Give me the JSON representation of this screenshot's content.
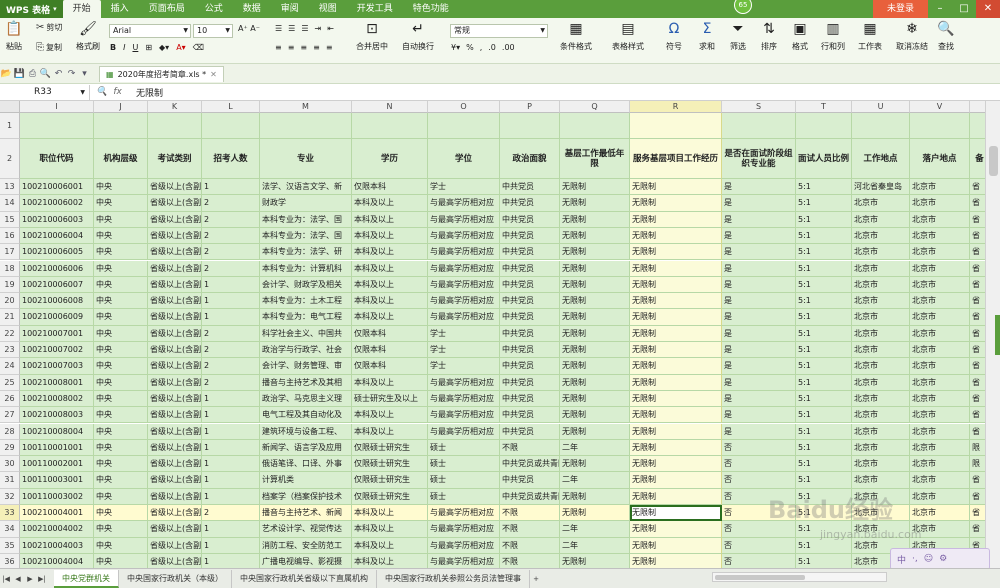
{
  "app": {
    "logo": "WPS 表格",
    "badge": "65",
    "login": "未登录"
  },
  "menu": [
    "开始",
    "插入",
    "页面布局",
    "公式",
    "数据",
    "审阅",
    "视图",
    "开发工具",
    "特色功能"
  ],
  "ribbon": {
    "paste": "粘贴",
    "cut": "剪切",
    "copy": "复制",
    "format_painter": "格式刷",
    "font_name": "Arial",
    "font_size": "10",
    "number_format": "常规",
    "merge_center": "合并居中",
    "wrap": "自动换行",
    "cond_format": "条件格式",
    "table_style": "表格样式",
    "symbol": "符号",
    "sum": "求和",
    "filter": "筛选",
    "sort": "排序",
    "format": "格式",
    "row_col": "行和列",
    "worksheet": "工作表",
    "freeze": "取消冻结",
    "find": "查找"
  },
  "doc_tab": "2020年度招考简章.xls *",
  "formula": {
    "cell_ref": "R33",
    "fx": "fx",
    "content": "无限制"
  },
  "columns": [
    "I",
    "J",
    "K",
    "L",
    "M",
    "N",
    "O",
    "P",
    "Q",
    "R",
    "S",
    "T",
    "U",
    "V",
    ""
  ],
  "header_row": {
    "row": "2",
    "cells": [
      "职位代码",
      "机构层级",
      "考试类别",
      "招考人数",
      "专业",
      "学历",
      "学位",
      "政治面貌",
      "基层工作最低年限",
      "服务基层项目工作经历",
      "是否在面试阶段组织专业能",
      "面试人员比例",
      "工作地点",
      "落户地点",
      "备"
    ]
  },
  "rows": [
    {
      "n": "13",
      "c": [
        "100210006001",
        "中央",
        "省级以上(含副",
        "1",
        "法学、汉语言文学、新",
        "仅限本科",
        "学士",
        "中共党员",
        "无限制",
        "无限制",
        "是",
        "5:1",
        "河北省秦皇岛",
        "北京市",
        "省"
      ]
    },
    {
      "n": "14",
      "c": [
        "100210006002",
        "中央",
        "省级以上(含副",
        "2",
        "财政学",
        "本科及以上",
        "与最高学历相对应",
        "中共党员",
        "无限制",
        "无限制",
        "是",
        "5:1",
        "北京市",
        "北京市",
        "省"
      ]
    },
    {
      "n": "15",
      "c": [
        "100210006003",
        "中央",
        "省级以上(含副",
        "2",
        "本科专业为：法学、国",
        "本科及以上",
        "与最高学历相对应",
        "中共党员",
        "无限制",
        "无限制",
        "是",
        "5:1",
        "北京市",
        "北京市",
        "省"
      ]
    },
    {
      "n": "16",
      "c": [
        "100210006004",
        "中央",
        "省级以上(含副",
        "2",
        "本科专业为：法学、国",
        "本科及以上",
        "与最高学历相对应",
        "中共党员",
        "无限制",
        "无限制",
        "是",
        "5:1",
        "北京市",
        "北京市",
        "省"
      ]
    },
    {
      "n": "17",
      "c": [
        "100210006005",
        "中央",
        "省级以上(含副",
        "2",
        "本科专业为：法学、研",
        "本科及以上",
        "与最高学历相对应",
        "中共党员",
        "无限制",
        "无限制",
        "是",
        "5:1",
        "北京市",
        "北京市",
        "省"
      ]
    },
    {
      "n": "18",
      "c": [
        "100210006006",
        "中央",
        "省级以上(含副",
        "2",
        "本科专业为：计算机科",
        "本科及以上",
        "与最高学历相对应",
        "中共党员",
        "无限制",
        "无限制",
        "是",
        "5:1",
        "北京市",
        "北京市",
        "省"
      ]
    },
    {
      "n": "19",
      "c": [
        "100210006007",
        "中央",
        "省级以上(含副",
        "1",
        "会计学、财政学及相关",
        "本科及以上",
        "与最高学历相对应",
        "中共党员",
        "无限制",
        "无限制",
        "是",
        "5:1",
        "北京市",
        "北京市",
        "省"
      ]
    },
    {
      "n": "20",
      "c": [
        "100210006008",
        "中央",
        "省级以上(含副",
        "1",
        "本科专业为：土木工程",
        "本科及以上",
        "与最高学历相对应",
        "中共党员",
        "无限制",
        "无限制",
        "是",
        "5:1",
        "北京市",
        "北京市",
        "省"
      ]
    },
    {
      "n": "21",
      "c": [
        "100210006009",
        "中央",
        "省级以上(含副",
        "1",
        "本科专业为：电气工程",
        "本科及以上",
        "与最高学历相对应",
        "中共党员",
        "无限制",
        "无限制",
        "是",
        "5:1",
        "北京市",
        "北京市",
        "省"
      ]
    },
    {
      "n": "22",
      "c": [
        "100210007001",
        "中央",
        "省级以上(含副",
        "2",
        "科学社会主义、中国共",
        "仅限本科",
        "学士",
        "中共党员",
        "无限制",
        "无限制",
        "是",
        "5:1",
        "北京市",
        "北京市",
        "省"
      ]
    },
    {
      "n": "23",
      "c": [
        "100210007002",
        "中央",
        "省级以上(含副",
        "2",
        "政治学与行政学、社会",
        "仅限本科",
        "学士",
        "中共党员",
        "无限制",
        "无限制",
        "是",
        "5:1",
        "北京市",
        "北京市",
        "省"
      ]
    },
    {
      "n": "24",
      "c": [
        "100210007003",
        "中央",
        "省级以上(含副",
        "2",
        "会计学、财务管理、审",
        "仅限本科",
        "学士",
        "中共党员",
        "无限制",
        "无限制",
        "是",
        "5:1",
        "北京市",
        "北京市",
        "省"
      ]
    },
    {
      "n": "25",
      "c": [
        "100210008001",
        "中央",
        "省级以上(含副",
        "2",
        "播音与主持艺术及其相",
        "本科及以上",
        "与最高学历相对应",
        "中共党员",
        "无限制",
        "无限制",
        "是",
        "5:1",
        "北京市",
        "北京市",
        "省"
      ]
    },
    {
      "n": "26",
      "c": [
        "100210008002",
        "中央",
        "省级以上(含副",
        "1",
        "政治学、马克思主义理",
        "硕士研究生及以上",
        "与最高学历相对应",
        "中共党员",
        "无限制",
        "无限制",
        "是",
        "5:1",
        "北京市",
        "北京市",
        "省"
      ]
    },
    {
      "n": "27",
      "c": [
        "100210008003",
        "中央",
        "省级以上(含副",
        "1",
        "电气工程及其自动化及",
        "本科及以上",
        "与最高学历相对应",
        "中共党员",
        "无限制",
        "无限制",
        "是",
        "5:1",
        "北京市",
        "北京市",
        "省"
      ]
    },
    {
      "n": "28",
      "c": [
        "100210008004",
        "中央",
        "省级以上(含副",
        "1",
        "建筑环境与设备工程、",
        "本科及以上",
        "与最高学历相对应",
        "中共党员",
        "无限制",
        "无限制",
        "是",
        "5:1",
        "北京市",
        "北京市",
        "省"
      ]
    },
    {
      "n": "29",
      "c": [
        "100110001001",
        "中央",
        "省级以上(含副",
        "1",
        "新闻学、语言学及应用",
        "仅限硕士研究生",
        "硕士",
        "不限",
        "二年",
        "无限制",
        "否",
        "5:1",
        "北京市",
        "北京市",
        "限"
      ]
    },
    {
      "n": "30",
      "c": [
        "100110002001",
        "中央",
        "省级以上(含副",
        "1",
        "俄语笔译、口译、外事",
        "仅限硕士研究生",
        "硕士",
        "中共党员或共青团员",
        "无限制",
        "无限制",
        "否",
        "5:1",
        "北京市",
        "北京市",
        "限"
      ]
    },
    {
      "n": "31",
      "c": [
        "100110003001",
        "中央",
        "省级以上(含副",
        "1",
        "计算机类",
        "仅限硕士研究生",
        "硕士",
        "中共党员",
        "二年",
        "无限制",
        "否",
        "5:1",
        "北京市",
        "北京市",
        "省"
      ]
    },
    {
      "n": "32",
      "c": [
        "100110003002",
        "中央",
        "省级以上(含副",
        "1",
        "档案学（档案保护技术",
        "仅限硕士研究生",
        "硕士",
        "中共党员或共青团员",
        "无限制",
        "无限制",
        "否",
        "5:1",
        "北京市",
        "北京市",
        "省"
      ]
    },
    {
      "n": "33",
      "c": [
        "100210004001",
        "中央",
        "省级以上(含副",
        "2",
        "播音与主持艺术、新闻",
        "本科及以上",
        "与最高学历相对应",
        "不限",
        "无限制",
        "无限制",
        "否",
        "5:1",
        "北京市",
        "北京市",
        "省"
      ]
    },
    {
      "n": "34",
      "c": [
        "100210004002",
        "中央",
        "省级以上(含副",
        "1",
        "艺术设计学、视觉传达",
        "本科及以上",
        "与最高学历相对应",
        "不限",
        "二年",
        "无限制",
        "否",
        "5:1",
        "北京市",
        "北京市",
        "省"
      ]
    },
    {
      "n": "35",
      "c": [
        "100210004003",
        "中央",
        "省级以上(含副",
        "1",
        "消防工程、安全防范工",
        "本科及以上",
        "与最高学历相对应",
        "不限",
        "二年",
        "无限制",
        "否",
        "5:1",
        "北京市",
        "北京市",
        "省"
      ]
    },
    {
      "n": "36",
      "c": [
        "100210004004",
        "中央",
        "省级以上(含副",
        "1",
        "广播电视编导、影视摄",
        "本科及以上",
        "与最高学历相对应",
        "不限",
        "无限制",
        "无限制",
        "否",
        "5:1",
        "北京市",
        "北京市",
        "省"
      ]
    }
  ],
  "row1": "1",
  "sheets": [
    "中央党群机关",
    "中央国家行政机关（本级）",
    "中央国家行政机关省级以下直属机构",
    "中央国家行政机关参照公务员法管理事"
  ],
  "ime": {
    "label": "中"
  },
  "watermark": {
    "main": "Baidu经验",
    "sub": "jingyan.baidu.com"
  }
}
